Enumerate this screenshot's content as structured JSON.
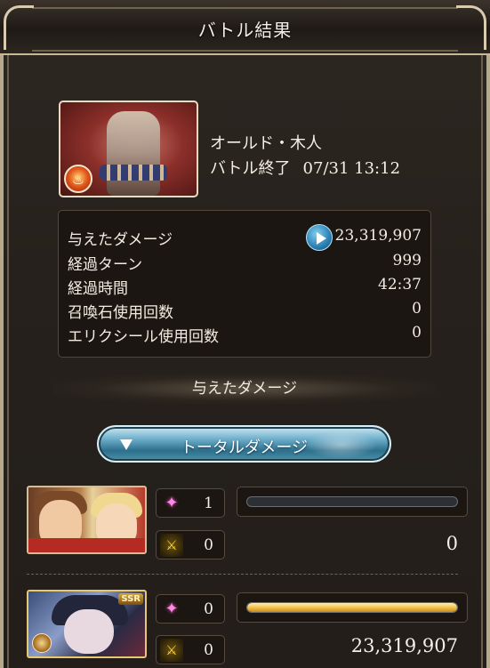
{
  "header": {
    "title": "バトル結果"
  },
  "enemy": {
    "name": "オールド・木人",
    "status": "バトル終了",
    "timestamp": "07/31 13:12",
    "element_icon": "fire-element-icon"
  },
  "stats": [
    {
      "label": "与えたダメージ",
      "value": "23,319,907",
      "has_play": true
    },
    {
      "label": "経過ターン",
      "value": "999"
    },
    {
      "label": "経過時間",
      "value": "42:37"
    },
    {
      "label": "召喚石使用回数",
      "value": "0"
    },
    {
      "label": "エリクシール使用回数",
      "value": "0"
    }
  ],
  "damage_section": {
    "title": "与えたダメージ"
  },
  "total_damage_button": {
    "label": "トータルダメージ"
  },
  "characters": [
    {
      "sparkle_count": "1",
      "attack_count": "0",
      "damage": "0",
      "damage_ratio": 0
    },
    {
      "rarity": "SSR",
      "sparkle_count": "0",
      "attack_count": "0",
      "damage": "23,319,907",
      "damage_ratio": 1
    }
  ],
  "colors": {
    "accent_blue": "#2d6f8c",
    "bar_gold": "#f2c24e",
    "panel_bg": "#1b1612",
    "frame": "#b9a98c"
  }
}
